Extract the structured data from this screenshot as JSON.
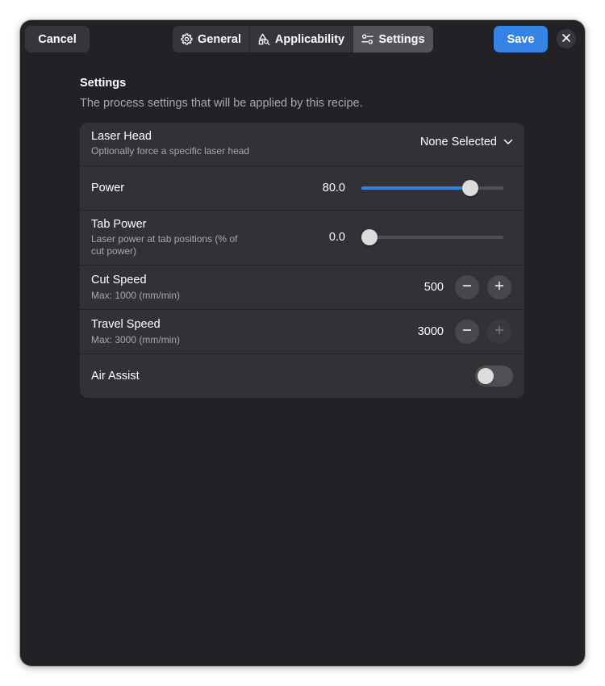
{
  "header": {
    "cancel_label": "Cancel",
    "save_label": "Save",
    "tabs": [
      {
        "label": "General",
        "icon": "gear-icon"
      },
      {
        "label": "Applicability",
        "icon": "shapes-search-icon"
      },
      {
        "label": "Settings",
        "icon": "sliders-icon",
        "active": true
      }
    ],
    "close_icon": "close-icon"
  },
  "page": {
    "title": "Settings",
    "description": "The process settings that will be applied by this recipe."
  },
  "rows": {
    "laser_head": {
      "title": "Laser Head",
      "subtitle": "Optionally force a specific laser head",
      "selected": "None Selected"
    },
    "power": {
      "title": "Power",
      "value": "80.0",
      "fraction": 0.8
    },
    "tab_power": {
      "title": "Tab Power",
      "subtitle": "Laser power at tab positions (% of cut power)",
      "value": "0.0",
      "fraction": 0.0
    },
    "cut_speed": {
      "title": "Cut Speed",
      "subtitle": "Max: 1000 (mm/min)",
      "value": "500"
    },
    "travel_speed": {
      "title": "Travel Speed",
      "subtitle": "Max: 3000 (mm/min)",
      "value": "3000",
      "plus_disabled": true
    },
    "air_assist": {
      "title": "Air Assist",
      "enabled": false
    }
  },
  "colors": {
    "accent": "#3584e4",
    "window_bg": "#222226",
    "card_bg": "#323236"
  }
}
